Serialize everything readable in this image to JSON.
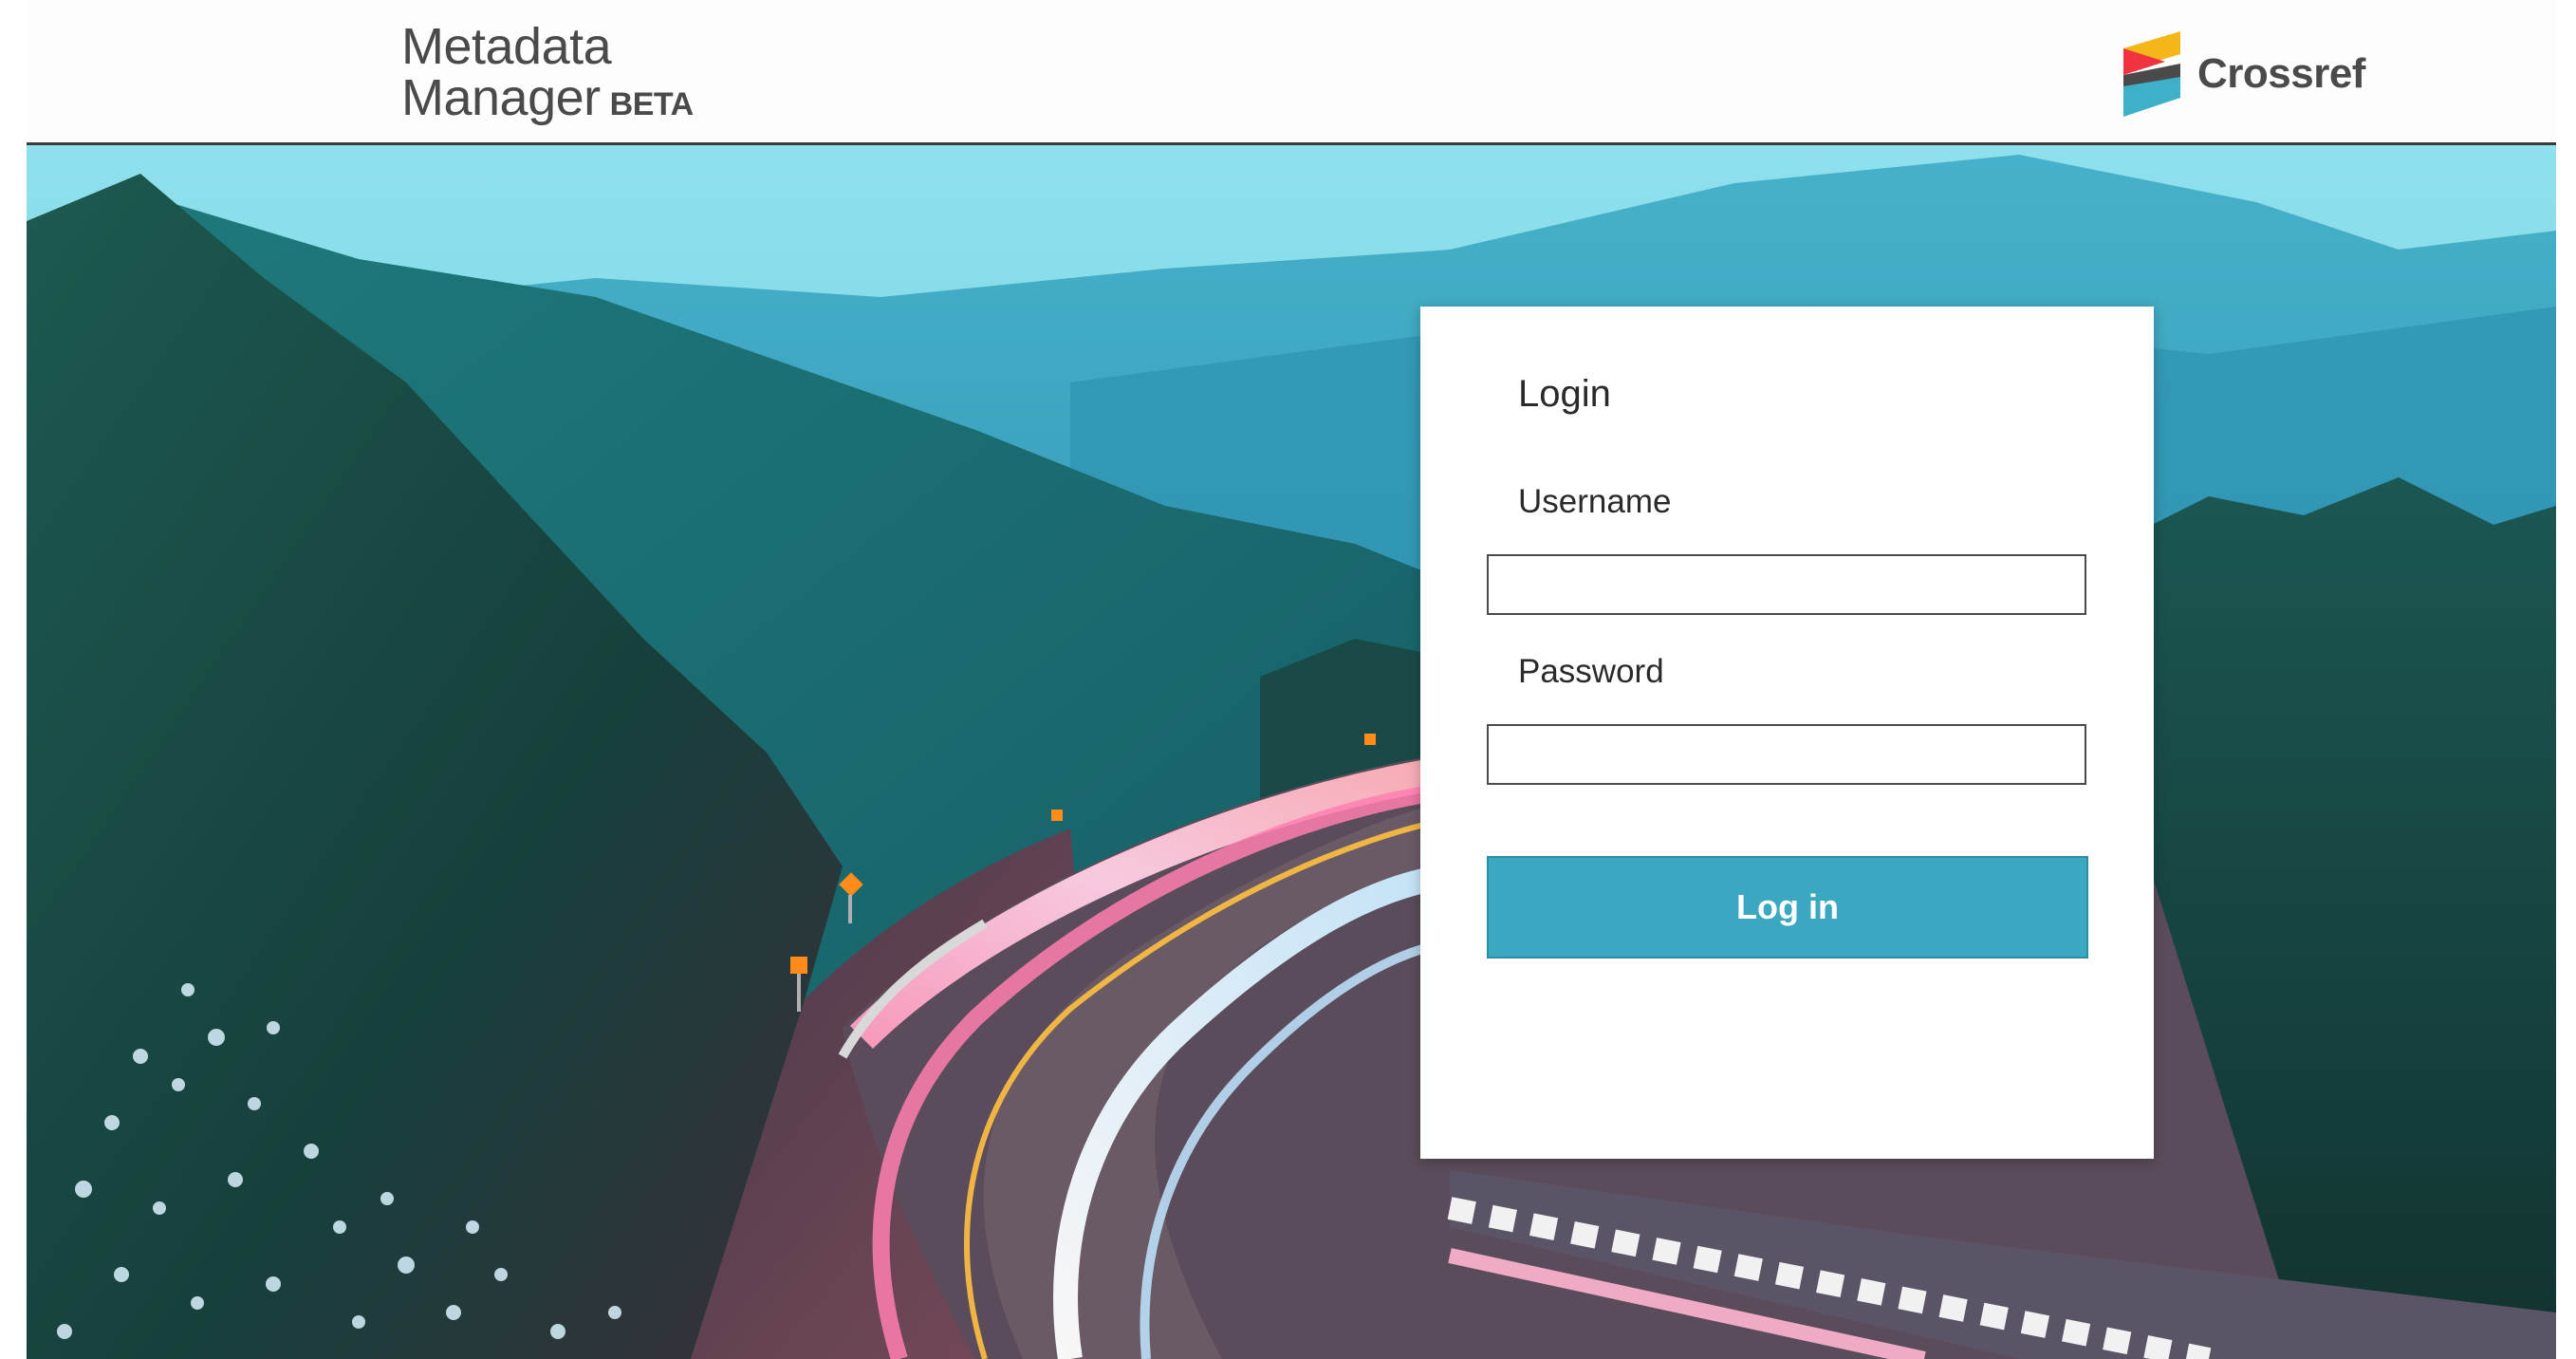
{
  "header": {
    "brand_line1": "Metadata",
    "brand_line2": "Manager",
    "brand_beta": "BETA",
    "partner_logo_text": "Crossref",
    "partner_logo_icon": "crossref-mark-icon"
  },
  "hero": {
    "image": "mountain-road-light-trails"
  },
  "login": {
    "title": "Login",
    "username_label": "Username",
    "username_value": "",
    "username_placeholder": "",
    "password_label": "Password",
    "password_value": "",
    "password_placeholder": "",
    "submit_label": "Log in"
  },
  "colors": {
    "button": "#3aa8c1",
    "logo_yellow": "#f5b61a",
    "logo_red": "#ef3340",
    "logo_teal": "#3eb1c8",
    "logo_gray": "#4a4a4a"
  }
}
